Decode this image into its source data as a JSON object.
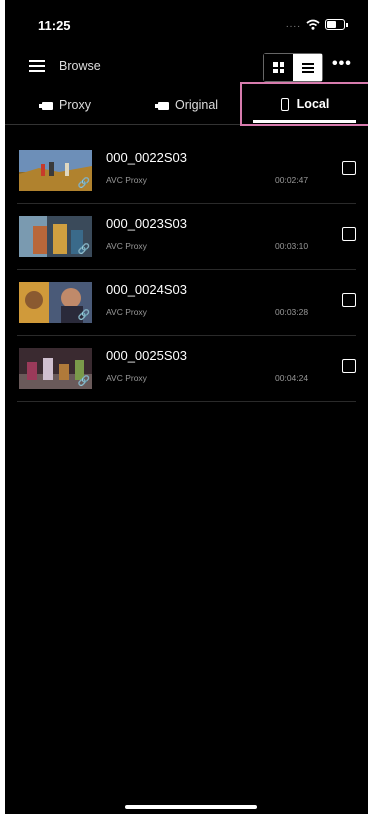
{
  "status_bar": {
    "time": "11:25",
    "signal": "....",
    "icons": [
      "wifi-icon",
      "battery-icon"
    ]
  },
  "header": {
    "menu_icon": "hamburger-menu-icon",
    "title": "Browse",
    "view_modes": [
      "grid-view-icon",
      "list-view-icon"
    ],
    "active_view": "list",
    "more_label": "•••"
  },
  "tabs": {
    "proxy": "Proxy",
    "original": "Original",
    "local": "Local",
    "selected": "local",
    "highlight_color": "#d77cae"
  },
  "clips": [
    {
      "name": "000_0022S03",
      "codec": "AVC Proxy",
      "duration": "00:02:47"
    },
    {
      "name": "000_0023S03",
      "codec": "AVC Proxy",
      "duration": "00:03:10"
    },
    {
      "name": "000_0024S03",
      "codec": "AVC Proxy",
      "duration": "00:03:28"
    },
    {
      "name": "000_0025S03",
      "codec": "AVC Proxy",
      "duration": "00:04:24"
    }
  ]
}
